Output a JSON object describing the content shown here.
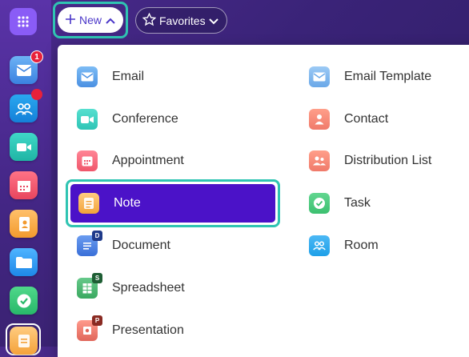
{
  "topbar": {
    "new_label": "New",
    "favorites_label": "Favorites"
  },
  "rail": {
    "apps": [
      {
        "name": "mail",
        "badge": "1"
      },
      {
        "name": "contacts"
      },
      {
        "name": "conference"
      },
      {
        "name": "calendar"
      },
      {
        "name": "address-book"
      },
      {
        "name": "files"
      },
      {
        "name": "tasks"
      },
      {
        "name": "notes"
      }
    ]
  },
  "menu": {
    "left": [
      {
        "label": "Email",
        "icon": "email-icon",
        "color": "#4a90e2"
      },
      {
        "label": "Conference",
        "icon": "video-icon",
        "color": "#2ec4b6"
      },
      {
        "label": "Appointment",
        "icon": "calendar-icon",
        "color": "#f0566b"
      },
      {
        "label": "Note",
        "icon": "note-icon",
        "color": "#f2a43a",
        "selected": true
      },
      {
        "label": "Document",
        "icon": "document-icon",
        "color": "#3a6fd8",
        "sub": "D"
      },
      {
        "label": "Spreadsheet",
        "icon": "spreadsheet-icon",
        "color": "#3aa860",
        "sub": "S"
      },
      {
        "label": "Presentation",
        "icon": "presentation-icon",
        "color": "#e0665a",
        "sub": "P"
      }
    ],
    "right": [
      {
        "label": "Email Template",
        "icon": "email-template-icon",
        "color": "#6aa8e8"
      },
      {
        "label": "Contact",
        "icon": "contact-icon",
        "color": "#f07a6a"
      },
      {
        "label": "Distribution List",
        "icon": "distribution-list-icon",
        "color": "#f07a6a"
      },
      {
        "label": "Task",
        "icon": "task-icon",
        "color": "#3cc070"
      },
      {
        "label": "Room",
        "icon": "room-icon",
        "color": "#1ea0e8"
      }
    ]
  }
}
